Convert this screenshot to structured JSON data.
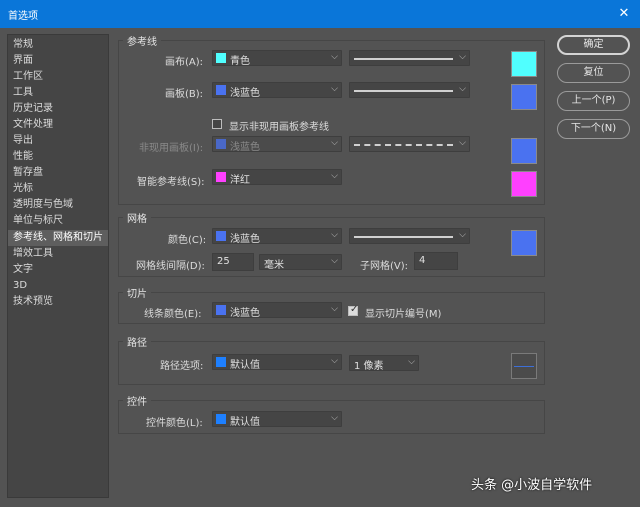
{
  "window": {
    "title": "首选项"
  },
  "sidebar": {
    "items": [
      {
        "label": "常规"
      },
      {
        "label": "界面"
      },
      {
        "label": "工作区"
      },
      {
        "label": "工具"
      },
      {
        "label": "历史记录"
      },
      {
        "label": "文件处理"
      },
      {
        "label": "导出"
      },
      {
        "label": "性能"
      },
      {
        "label": "暂存盘"
      },
      {
        "label": "光标"
      },
      {
        "label": "透明度与色域"
      },
      {
        "label": "单位与标尺"
      },
      {
        "label": "参考线、网格和切片",
        "selected": true
      },
      {
        "label": "增效工具"
      },
      {
        "label": "文字"
      },
      {
        "label": "3D"
      },
      {
        "label": "技术预览"
      }
    ]
  },
  "guides": {
    "title": "参考线",
    "canvas": {
      "label": "画布(A):",
      "color": "青色",
      "swatch": "#50ffff"
    },
    "artboard": {
      "label": "画板(B):",
      "color": "浅蓝色",
      "swatch": "#4a72f0"
    },
    "show_inactive": {
      "label": "显示非现用画板参考线",
      "checked": false
    },
    "inactive": {
      "label": "非现用画板(I):",
      "color": "浅蓝色",
      "swatch": "#4a72f0",
      "disabled": true
    },
    "smart": {
      "label": "智能参考线(S):",
      "color": "洋红",
      "swatch": "#ff40ff"
    }
  },
  "grid": {
    "title": "网格",
    "color": {
      "label": "颜色(C):",
      "value": "浅蓝色",
      "swatch": "#4a72f0"
    },
    "gridline_every": {
      "label": "网格线间隔(D):",
      "value": "25"
    },
    "unit": {
      "value": "毫米"
    },
    "subdivisions": {
      "label": "子网格(V):",
      "value": "4"
    }
  },
  "slices": {
    "title": "切片",
    "line_color": {
      "label": "线条颜色(E):",
      "value": "浅蓝色",
      "swatch": "#4a72f0"
    },
    "show_numbers": {
      "label": "显示切片编号(M)",
      "checked": true
    }
  },
  "path": {
    "title": "路径",
    "options": {
      "label": "路径选项:",
      "value": "默认值",
      "swatch": "#1e80ff"
    },
    "width": {
      "value": "1 像素"
    }
  },
  "controls": {
    "title": "控件",
    "color": {
      "label": "控件颜色(L):",
      "value": "默认值",
      "swatch": "#1e80ff"
    }
  },
  "buttons": {
    "ok": "确定",
    "reset": "复位",
    "prev": "上一个(P)",
    "next": "下一个(N)"
  },
  "watermark": "头条 @小波自学软件",
  "icons": {
    "close": "close-icon",
    "chevron": "chevron-down-icon",
    "check": "check-icon"
  }
}
